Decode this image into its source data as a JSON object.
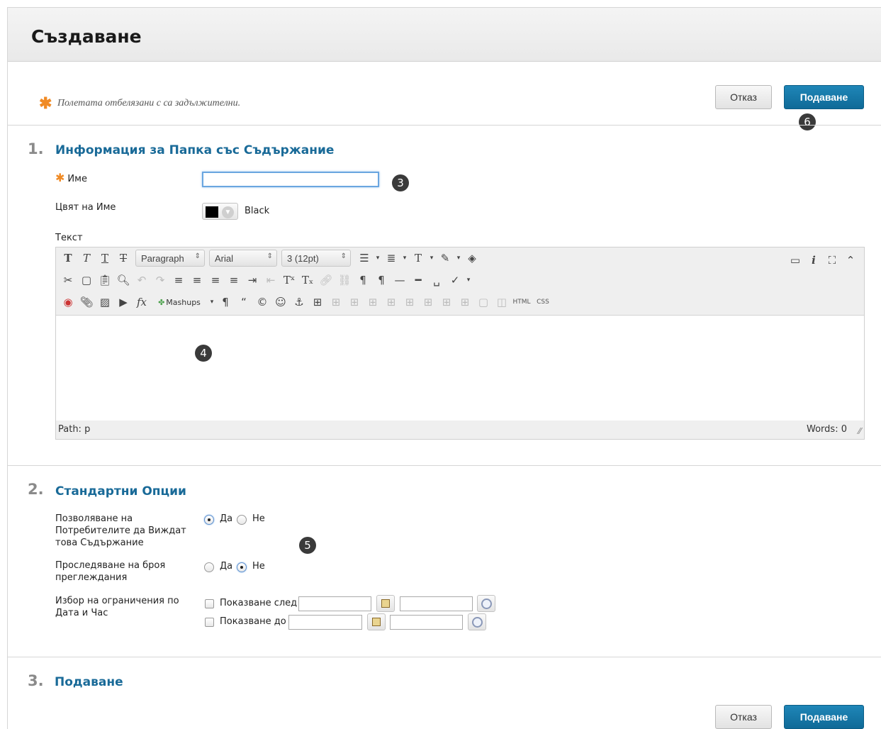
{
  "page": {
    "title": "Създаване",
    "required_note": "Полетата отбелязани с са задължителни.",
    "required_star": "✱"
  },
  "buttons": {
    "cancel": "Отказ",
    "submit": "Подаване"
  },
  "markers": [
    "3",
    "4",
    "5",
    "6"
  ],
  "section1": {
    "number": "1.",
    "title": "Информация за Папка със Съдържание",
    "name_label": "Име",
    "name_value": "",
    "color_label": "Цвят на Име",
    "color_value": "Black",
    "text_label": "Текст"
  },
  "editor": {
    "paragraph_select": "Paragraph",
    "font_select": "Arial",
    "size_select": "3 (12pt)",
    "mashups": "Mashups",
    "html_btn": "HTML",
    "css_btn": "CSS",
    "path": "Path: p",
    "words": "Words: 0"
  },
  "section2": {
    "number": "2.",
    "title": "Стандартни Опции",
    "permit_label": "Позволяване на Потребителите да Виждат това Съдържание",
    "permit_yes": "Да",
    "permit_no": "Не",
    "track_label": "Проследяване на броя преглеждания",
    "track_yes": "Да",
    "track_no": "Не",
    "date_label": "Избор на ограничения по Дата и Час",
    "show_after": "Показване след",
    "show_until": "Показване до"
  },
  "section3": {
    "number": "3.",
    "title": "Подаване"
  },
  "colors": {
    "accent": "#196a98",
    "submit_bg": "#1478a8",
    "required": "#f08a24"
  }
}
